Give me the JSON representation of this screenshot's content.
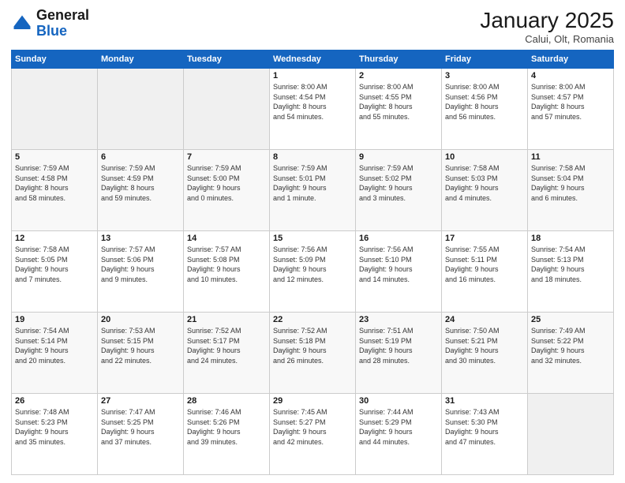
{
  "logo": {
    "line1": "General",
    "line2": "Blue"
  },
  "header": {
    "title": "January 2025",
    "subtitle": "Calui, Olt, Romania"
  },
  "weekdays": [
    "Sunday",
    "Monday",
    "Tuesday",
    "Wednesday",
    "Thursday",
    "Friday",
    "Saturday"
  ],
  "weeks": [
    [
      {
        "day": "",
        "info": ""
      },
      {
        "day": "",
        "info": ""
      },
      {
        "day": "",
        "info": ""
      },
      {
        "day": "1",
        "info": "Sunrise: 8:00 AM\nSunset: 4:54 PM\nDaylight: 8 hours\nand 54 minutes."
      },
      {
        "day": "2",
        "info": "Sunrise: 8:00 AM\nSunset: 4:55 PM\nDaylight: 8 hours\nand 55 minutes."
      },
      {
        "day": "3",
        "info": "Sunrise: 8:00 AM\nSunset: 4:56 PM\nDaylight: 8 hours\nand 56 minutes."
      },
      {
        "day": "4",
        "info": "Sunrise: 8:00 AM\nSunset: 4:57 PM\nDaylight: 8 hours\nand 57 minutes."
      }
    ],
    [
      {
        "day": "5",
        "info": "Sunrise: 7:59 AM\nSunset: 4:58 PM\nDaylight: 8 hours\nand 58 minutes."
      },
      {
        "day": "6",
        "info": "Sunrise: 7:59 AM\nSunset: 4:59 PM\nDaylight: 8 hours\nand 59 minutes."
      },
      {
        "day": "7",
        "info": "Sunrise: 7:59 AM\nSunset: 5:00 PM\nDaylight: 9 hours\nand 0 minutes."
      },
      {
        "day": "8",
        "info": "Sunrise: 7:59 AM\nSunset: 5:01 PM\nDaylight: 9 hours\nand 1 minute."
      },
      {
        "day": "9",
        "info": "Sunrise: 7:59 AM\nSunset: 5:02 PM\nDaylight: 9 hours\nand 3 minutes."
      },
      {
        "day": "10",
        "info": "Sunrise: 7:58 AM\nSunset: 5:03 PM\nDaylight: 9 hours\nand 4 minutes."
      },
      {
        "day": "11",
        "info": "Sunrise: 7:58 AM\nSunset: 5:04 PM\nDaylight: 9 hours\nand 6 minutes."
      }
    ],
    [
      {
        "day": "12",
        "info": "Sunrise: 7:58 AM\nSunset: 5:05 PM\nDaylight: 9 hours\nand 7 minutes."
      },
      {
        "day": "13",
        "info": "Sunrise: 7:57 AM\nSunset: 5:06 PM\nDaylight: 9 hours\nand 9 minutes."
      },
      {
        "day": "14",
        "info": "Sunrise: 7:57 AM\nSunset: 5:08 PM\nDaylight: 9 hours\nand 10 minutes."
      },
      {
        "day": "15",
        "info": "Sunrise: 7:56 AM\nSunset: 5:09 PM\nDaylight: 9 hours\nand 12 minutes."
      },
      {
        "day": "16",
        "info": "Sunrise: 7:56 AM\nSunset: 5:10 PM\nDaylight: 9 hours\nand 14 minutes."
      },
      {
        "day": "17",
        "info": "Sunrise: 7:55 AM\nSunset: 5:11 PM\nDaylight: 9 hours\nand 16 minutes."
      },
      {
        "day": "18",
        "info": "Sunrise: 7:54 AM\nSunset: 5:13 PM\nDaylight: 9 hours\nand 18 minutes."
      }
    ],
    [
      {
        "day": "19",
        "info": "Sunrise: 7:54 AM\nSunset: 5:14 PM\nDaylight: 9 hours\nand 20 minutes."
      },
      {
        "day": "20",
        "info": "Sunrise: 7:53 AM\nSunset: 5:15 PM\nDaylight: 9 hours\nand 22 minutes."
      },
      {
        "day": "21",
        "info": "Sunrise: 7:52 AM\nSunset: 5:17 PM\nDaylight: 9 hours\nand 24 minutes."
      },
      {
        "day": "22",
        "info": "Sunrise: 7:52 AM\nSunset: 5:18 PM\nDaylight: 9 hours\nand 26 minutes."
      },
      {
        "day": "23",
        "info": "Sunrise: 7:51 AM\nSunset: 5:19 PM\nDaylight: 9 hours\nand 28 minutes."
      },
      {
        "day": "24",
        "info": "Sunrise: 7:50 AM\nSunset: 5:21 PM\nDaylight: 9 hours\nand 30 minutes."
      },
      {
        "day": "25",
        "info": "Sunrise: 7:49 AM\nSunset: 5:22 PM\nDaylight: 9 hours\nand 32 minutes."
      }
    ],
    [
      {
        "day": "26",
        "info": "Sunrise: 7:48 AM\nSunset: 5:23 PM\nDaylight: 9 hours\nand 35 minutes."
      },
      {
        "day": "27",
        "info": "Sunrise: 7:47 AM\nSunset: 5:25 PM\nDaylight: 9 hours\nand 37 minutes."
      },
      {
        "day": "28",
        "info": "Sunrise: 7:46 AM\nSunset: 5:26 PM\nDaylight: 9 hours\nand 39 minutes."
      },
      {
        "day": "29",
        "info": "Sunrise: 7:45 AM\nSunset: 5:27 PM\nDaylight: 9 hours\nand 42 minutes."
      },
      {
        "day": "30",
        "info": "Sunrise: 7:44 AM\nSunset: 5:29 PM\nDaylight: 9 hours\nand 44 minutes."
      },
      {
        "day": "31",
        "info": "Sunrise: 7:43 AM\nSunset: 5:30 PM\nDaylight: 9 hours\nand 47 minutes."
      },
      {
        "day": "",
        "info": ""
      }
    ]
  ]
}
